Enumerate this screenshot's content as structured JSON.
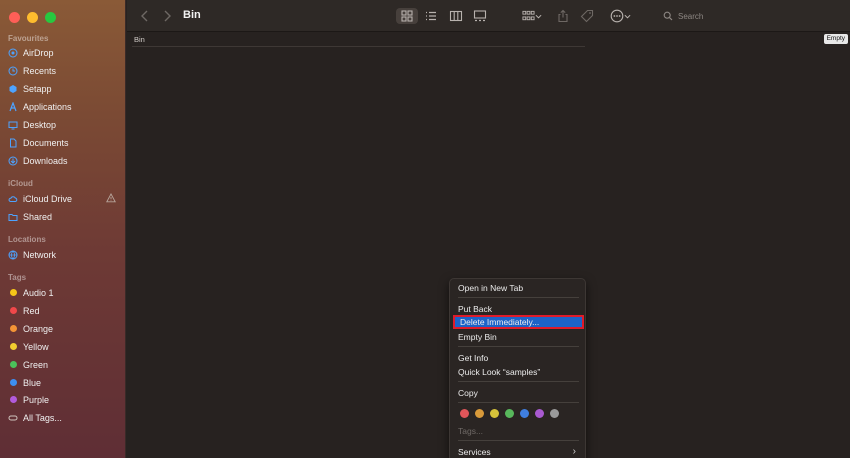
{
  "window": {
    "title": "Bin"
  },
  "sidebar": {
    "favourites_header": "Favourites",
    "favourites": [
      {
        "label": "AirDrop",
        "icon": "airdrop-icon"
      },
      {
        "label": "Recents",
        "icon": "clock-icon"
      },
      {
        "label": "Setapp",
        "icon": "setapp-icon"
      },
      {
        "label": "Applications",
        "icon": "applications-icon"
      },
      {
        "label": "Desktop",
        "icon": "desktop-icon"
      },
      {
        "label": "Documents",
        "icon": "document-icon"
      },
      {
        "label": "Downloads",
        "icon": "download-icon"
      }
    ],
    "icloud_header": "iCloud",
    "icloud": [
      {
        "label": "iCloud Drive",
        "icon": "cloud-icon"
      },
      {
        "label": "Shared",
        "icon": "shared-folder-icon"
      }
    ],
    "locations_header": "Locations",
    "locations": [
      {
        "label": "Network",
        "icon": "network-icon"
      }
    ],
    "tags_header": "Tags",
    "tags": [
      {
        "label": "Audio 1",
        "color": "#f5c518"
      },
      {
        "label": "Red",
        "color": "#f0484a"
      },
      {
        "label": "Orange",
        "color": "#f39436"
      },
      {
        "label": "Yellow",
        "color": "#f2cd2f"
      },
      {
        "label": "Green",
        "color": "#4bc35a"
      },
      {
        "label": "Blue",
        "color": "#3d8ef0"
      },
      {
        "label": "Purple",
        "color": "#b25bdc"
      },
      {
        "label": "All Tags...",
        "color": ""
      }
    ]
  },
  "toolbar": {
    "search_placeholder": "Search"
  },
  "content": {
    "path_label": "Bin",
    "empty_button": "Empty"
  },
  "context_menu": {
    "items": {
      "open_new_tab": "Open in New Tab",
      "put_back": "Put Back",
      "delete_immediately": "Delete Immediately...",
      "empty_bin": "Empty Bin",
      "get_info": "Get Info",
      "quick_look": "Quick Look “samples”",
      "copy": "Copy",
      "tags": "Tags...",
      "services": "Services"
    },
    "tag_colors": [
      "#e0565a",
      "#d89a3a",
      "#d6c23a",
      "#58b85c",
      "#3f7fe0",
      "#a95ad0",
      "#9a9a9a"
    ],
    "highlight_color": "#1d63c8"
  }
}
